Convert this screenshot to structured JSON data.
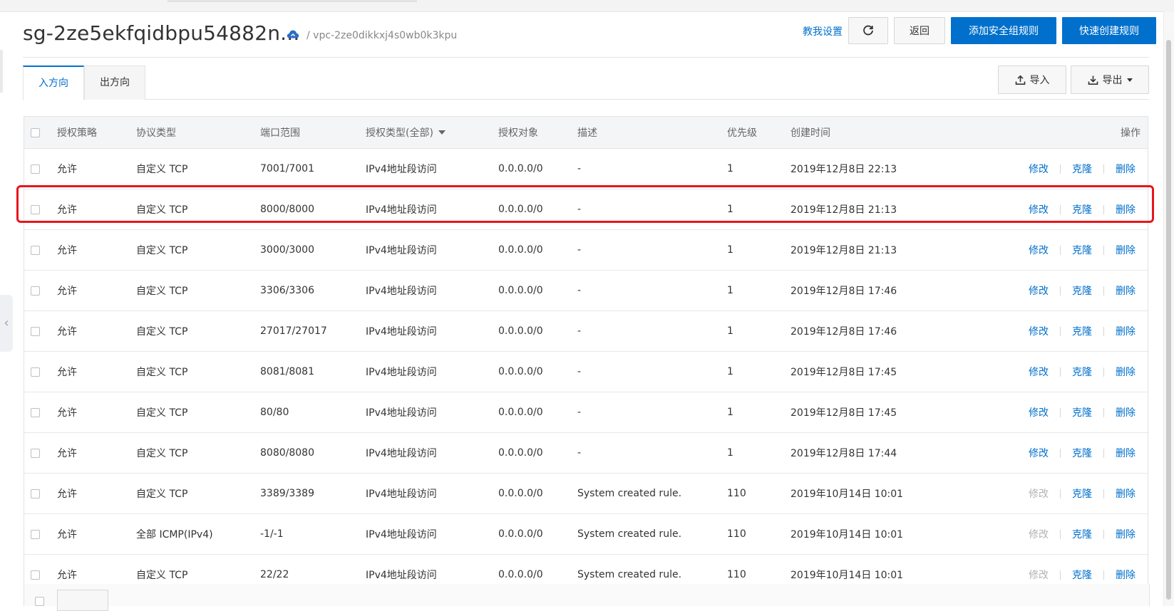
{
  "header": {
    "title": "sg-2ze5ekfqidbpu54882n...",
    "vpc": "/ vpc-2ze0dikkxj4s0wb0k3kpu",
    "help_link": "教我设置",
    "back_label": "返回",
    "add_rule_label": "添加安全组规则",
    "quick_create_label": "快速创建规则"
  },
  "tabs": [
    {
      "label": "入方向",
      "active": true
    },
    {
      "label": "出方向",
      "active": false
    }
  ],
  "toolbar": {
    "import_label": "导入",
    "export_label": "导出"
  },
  "table": {
    "columns": {
      "policy": "授权策略",
      "protocol": "协议类型",
      "port": "端口范围",
      "auth_type": "授权类型(全部)",
      "target": "授权对象",
      "description": "描述",
      "priority": "优先级",
      "created": "创建时间",
      "actions": "操作"
    },
    "actions": {
      "edit": "修改",
      "clone": "克隆",
      "delete": "删除"
    },
    "rows": [
      {
        "policy": "允许",
        "protocol": "自定义 TCP",
        "port": "7001/7001",
        "auth_type": "IPv4地址段访问",
        "target": "0.0.0.0/0",
        "description": "-",
        "priority": "1",
        "created": "2019年12月8日 22:13",
        "edit_enabled": true
      },
      {
        "policy": "允许",
        "protocol": "自定义 TCP",
        "port": "8000/8000",
        "auth_type": "IPv4地址段访问",
        "target": "0.0.0.0/0",
        "description": "-",
        "priority": "1",
        "created": "2019年12月8日 21:13",
        "edit_enabled": true,
        "highlighted": true
      },
      {
        "policy": "允许",
        "protocol": "自定义 TCP",
        "port": "3000/3000",
        "auth_type": "IPv4地址段访问",
        "target": "0.0.0.0/0",
        "description": "-",
        "priority": "1",
        "created": "2019年12月8日 21:13",
        "edit_enabled": true
      },
      {
        "policy": "允许",
        "protocol": "自定义 TCP",
        "port": "3306/3306",
        "auth_type": "IPv4地址段访问",
        "target": "0.0.0.0/0",
        "description": "-",
        "priority": "1",
        "created": "2019年12月8日 17:46",
        "edit_enabled": true
      },
      {
        "policy": "允许",
        "protocol": "自定义 TCP",
        "port": "27017/27017",
        "auth_type": "IPv4地址段访问",
        "target": "0.0.0.0/0",
        "description": "-",
        "priority": "1",
        "created": "2019年12月8日 17:46",
        "edit_enabled": true
      },
      {
        "policy": "允许",
        "protocol": "自定义 TCP",
        "port": "8081/8081",
        "auth_type": "IPv4地址段访问",
        "target": "0.0.0.0/0",
        "description": "-",
        "priority": "1",
        "created": "2019年12月8日 17:45",
        "edit_enabled": true
      },
      {
        "policy": "允许",
        "protocol": "自定义 TCP",
        "port": "80/80",
        "auth_type": "IPv4地址段访问",
        "target": "0.0.0.0/0",
        "description": "-",
        "priority": "1",
        "created": "2019年12月8日 17:45",
        "edit_enabled": true
      },
      {
        "policy": "允许",
        "protocol": "自定义 TCP",
        "port": "8080/8080",
        "auth_type": "IPv4地址段访问",
        "target": "0.0.0.0/0",
        "description": "-",
        "priority": "1",
        "created": "2019年12月8日 17:44",
        "edit_enabled": true
      },
      {
        "policy": "允许",
        "protocol": "自定义 TCP",
        "port": "3389/3389",
        "auth_type": "IPv4地址段访问",
        "target": "0.0.0.0/0",
        "description": "System created rule.",
        "priority": "110",
        "created": "2019年10月14日 10:01",
        "edit_enabled": false
      },
      {
        "policy": "允许",
        "protocol": "全部 ICMP(IPv4)",
        "port": "-1/-1",
        "auth_type": "IPv4地址段访问",
        "target": "0.0.0.0/0",
        "description": "System created rule.",
        "priority": "110",
        "created": "2019年10月14日 10:01",
        "edit_enabled": false
      },
      {
        "policy": "允许",
        "protocol": "自定义 TCP",
        "port": "22/22",
        "auth_type": "IPv4地址段访问",
        "target": "0.0.0.0/0",
        "description": "System created rule.",
        "priority": "110",
        "created": "2019年10月14日 10:01",
        "edit_enabled": false
      }
    ]
  },
  "colors": {
    "primary": "#0070cc",
    "highlight": "#e8161c",
    "disabled_link": "#b3b3b3"
  },
  "icons": {
    "refresh": "refresh-icon",
    "cloud": "cloud-icon",
    "import": "upload-icon",
    "export": "download-icon"
  }
}
